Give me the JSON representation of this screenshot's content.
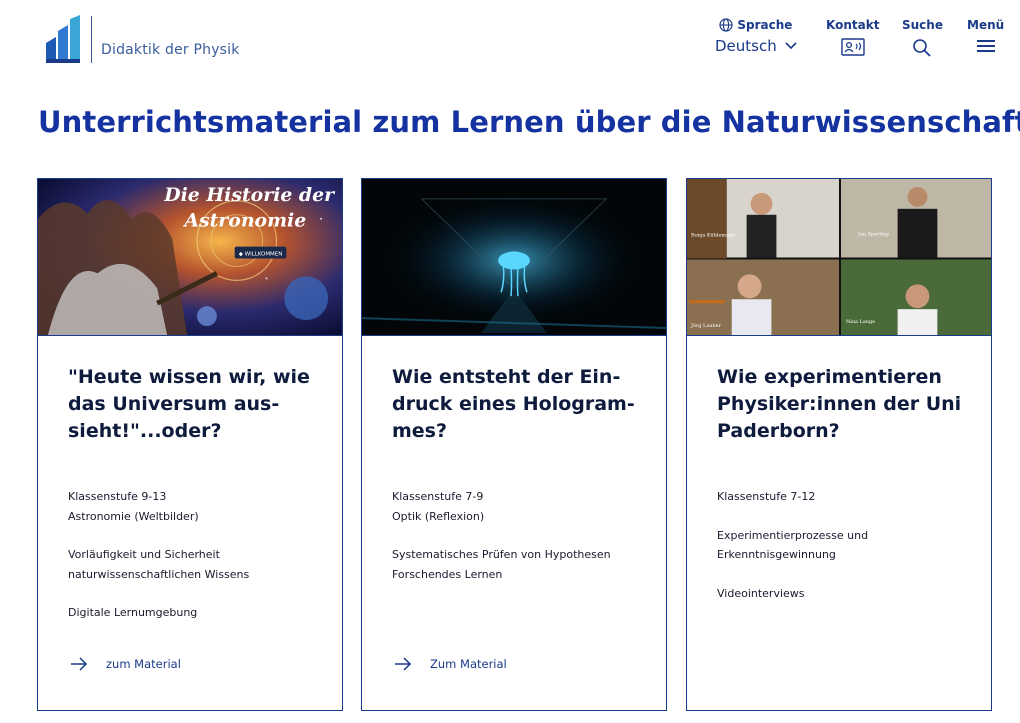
{
  "header": {
    "site_name": "Didaktik der Physik",
    "language": {
      "label": "Sprache",
      "value": "Deutsch"
    },
    "contact": {
      "label": "Kontakt"
    },
    "search": {
      "label": "Suche"
    },
    "menu": {
      "label": "Menü"
    }
  },
  "page_title": "Unterrichtsmaterial zum Lernen über die Naturwissenschaften",
  "cards": [
    {
      "image_caption_1": "Die Historie der",
      "image_caption_2": "Astronomie",
      "image_badge": "◆ WILLKOMMEN",
      "title": "\"Heute wissen wir, wie das Universum aus-sieht!\"...oder?",
      "meta": [
        [
          "Klassenstufe 9-13",
          "Astronomie (Weltbilder)"
        ],
        [
          "Vorläufigkeit und Sicherheit",
          "naturwissenschaftlichen Wissens"
        ],
        [
          "Digitale Lernumgebung"
        ]
      ],
      "link": "zum Material"
    },
    {
      "title": "Wie entsteht der Ein-druck eines Hologram-mes?",
      "meta": [
        [
          "Klassenstufe 7-9",
          "Optik (Reflexion)"
        ],
        [
          "Systematisches Prüfen von Hypothesen",
          "Forschendes Lernen"
        ]
      ],
      "link": "Zum Material"
    },
    {
      "video_names": [
        "Ronja Kühlemann",
        "Jan Sperling",
        "Jörg Lauber",
        "Nina Lange"
      ],
      "title": "Wie experimentieren Physiker:innen der Uni Paderborn?",
      "meta": [
        [
          "Klassenstufe 7-12"
        ],
        [
          "Experimentierprozesse und",
          "Erkenntnisgewinnung"
        ],
        [
          "Videointerviews"
        ]
      ]
    }
  ],
  "colors": {
    "accent": "#1432a0",
    "nav": "#1a3a8a",
    "border": "#1a3a8a"
  }
}
